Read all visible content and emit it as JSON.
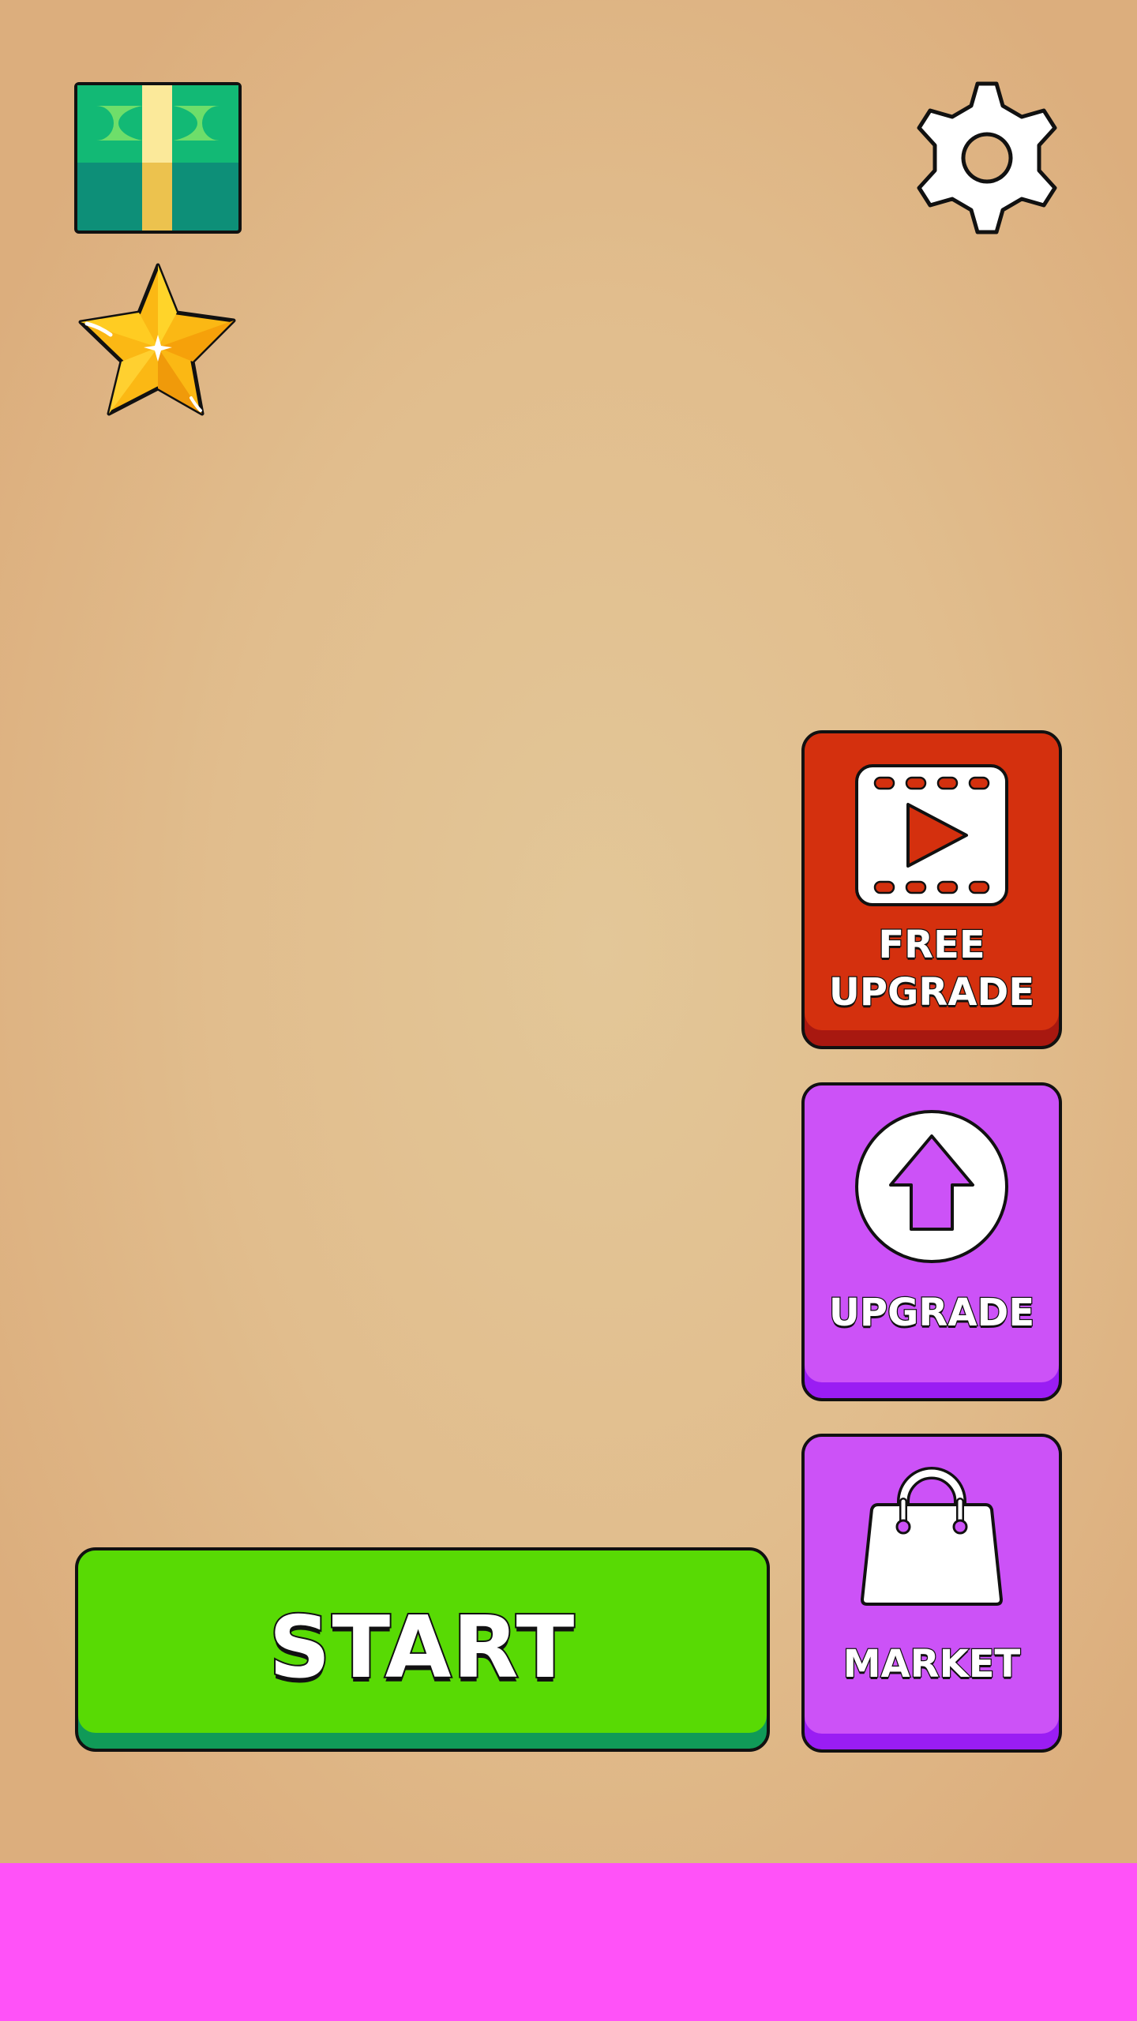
{
  "colors": {
    "background": "#e1bd8d",
    "ad_banner": "#ff52f8",
    "free_upgrade_button": "#d4300e",
    "upgrade_button": "#cc52f7",
    "market_button": "#cc52f7",
    "start_button": "#58da04"
  },
  "hud": {
    "currency_icon": "cash-icon",
    "stars_icon": "star-icon",
    "settings_icon": "gear-icon"
  },
  "buttons": {
    "free_upgrade": {
      "line1": "FREE",
      "line2": "UPGRADE",
      "icon": "video-play-icon"
    },
    "upgrade": {
      "label": "UPGRADE",
      "icon": "arrow-up-icon"
    },
    "market": {
      "label": "MARKET",
      "icon": "shopping-bag-icon"
    },
    "start": {
      "label": "START"
    }
  }
}
